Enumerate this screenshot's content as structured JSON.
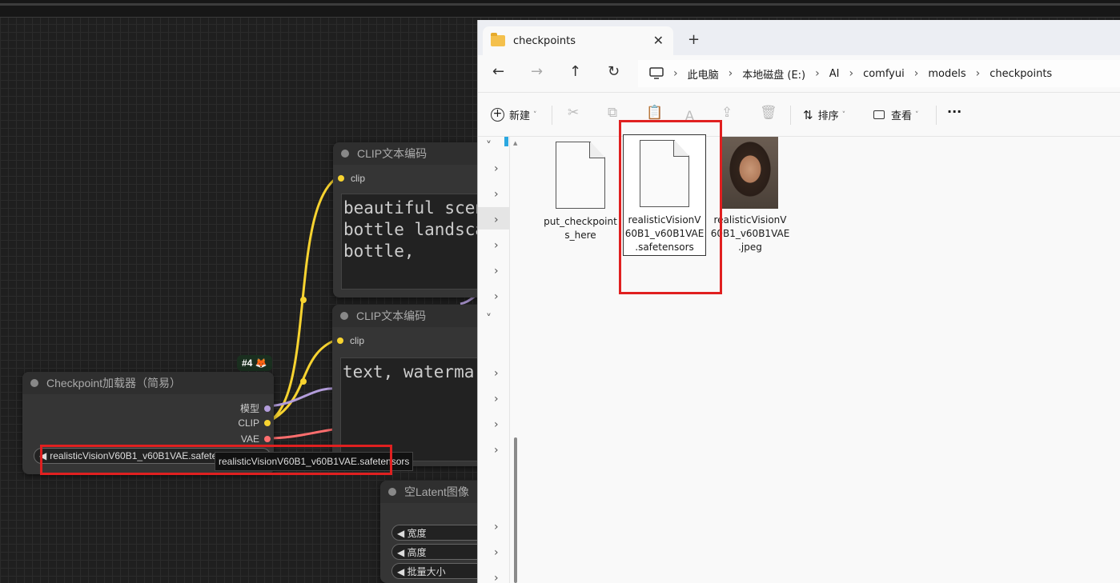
{
  "comfy": {
    "clip_node_1": {
      "title": "CLIP文本编码",
      "input": "clip",
      "text": "beautiful scen\nbottle landsca\nbottle,"
    },
    "clip_node_2": {
      "title": "CLIP文本编码",
      "input": "clip",
      "text": "text, watermar"
    },
    "checkpoint_node": {
      "badge": "#4 🦊",
      "title": "Checkpoint加载器（简易）",
      "outputs": [
        "模型",
        "CLIP",
        "VAE"
      ],
      "ckpt_value": "realisticVisionV60B1_v60B1VAE.safete",
      "tooltip": "realisticVisionV60B1_v60B1VAE.safetensors"
    },
    "latent_node": {
      "title": "空Latent图像",
      "widgets": [
        "◀ 宽度",
        "◀ 高度",
        "◀ 批量大小"
      ]
    },
    "colors": {
      "clip": "#f7d330",
      "model": "#b39ddb",
      "vae": "#ff6e6e",
      "highlight": "#e02020"
    }
  },
  "explorer": {
    "tab_title": "checkpoints",
    "tab_close": "✕",
    "tab_new": "+",
    "nav": {
      "back": "←",
      "forward": "→",
      "up": "↑",
      "refresh": "↻"
    },
    "breadcrumbs": [
      "此电脑",
      "本地磁盘 (E:)",
      "AI",
      "comfyui",
      "models",
      "checkpoints"
    ],
    "toolbar": {
      "new_label": "新建",
      "sort_label": "排序",
      "view_label": "查看",
      "more": "···"
    },
    "files": [
      {
        "name_line1": "put_checkpoint",
        "name_line2": "s_here",
        "name_line3": "",
        "type": "document-icon"
      },
      {
        "name_line1": "realisticVisionV",
        "name_line2": "60B1_v60B1VAE",
        "name_line3": ".safetensors",
        "type": "document-icon"
      },
      {
        "name_line1": "realisticVisionV",
        "name_line2": "60B1_v60B1VAE",
        "name_line3": ".jpeg",
        "type": "photo-thumbnail"
      }
    ]
  }
}
